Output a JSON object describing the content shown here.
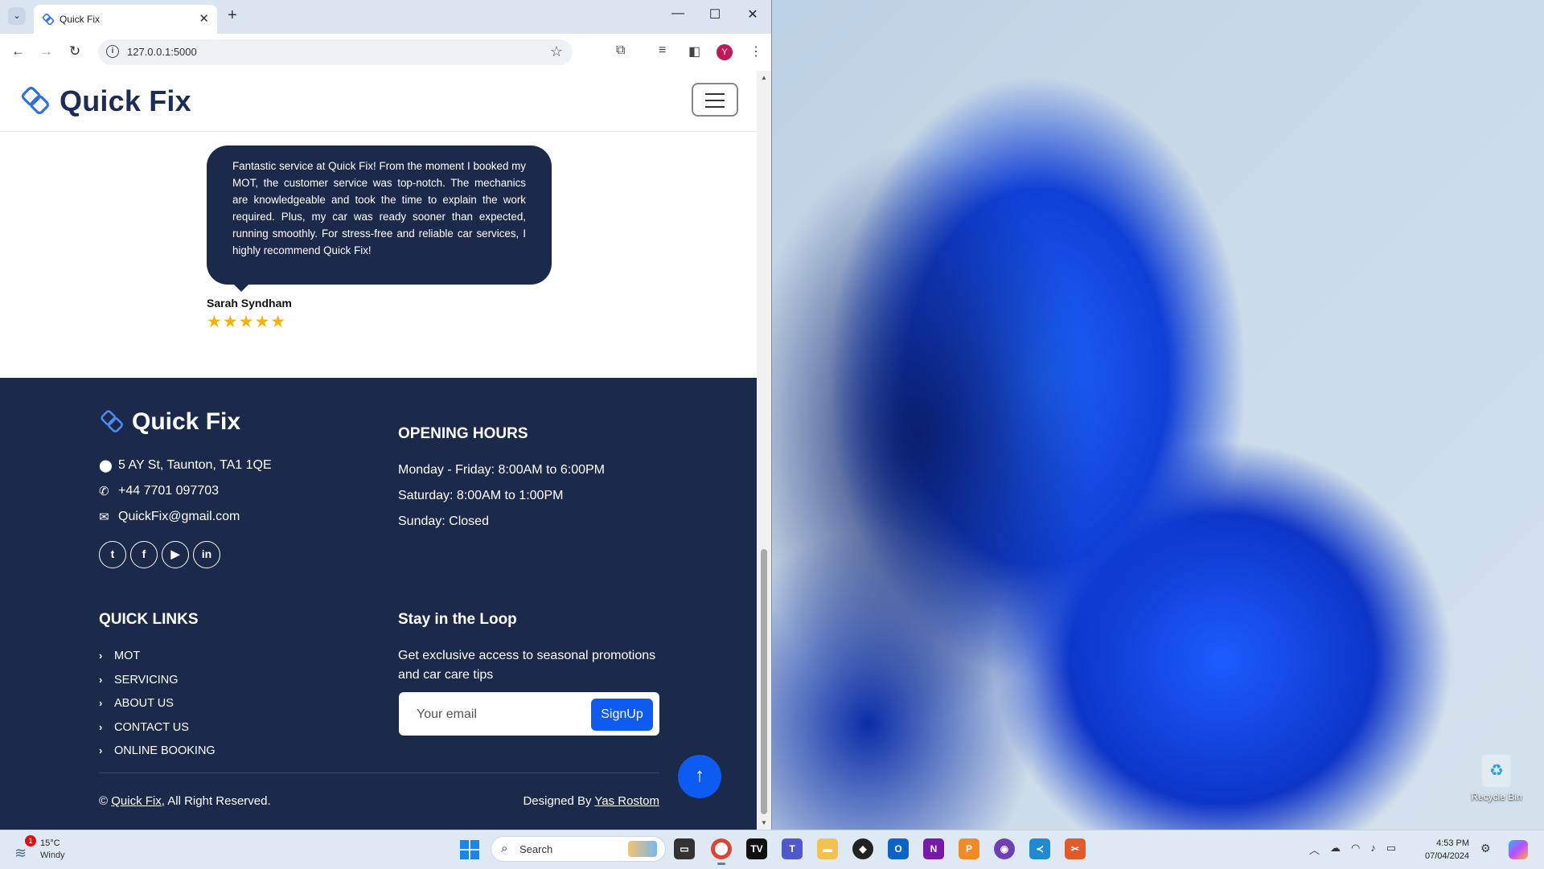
{
  "browser": {
    "tab_title": "Quick Fix",
    "url": "127.0.0.1:5000",
    "profile_initial": "Y"
  },
  "site": {
    "brand": "Quick Fix",
    "testimonial": {
      "text": "Fantastic service at Quick Fix! From the moment I booked my MOT, the customer service was top-notch. The mechanics are knowledgeable and took the time to explain the work required. Plus, my car was ready sooner than expected, running smoothly. For stress-free and reliable car services, I highly recommend Quick Fix!",
      "author": "Sarah Syndham",
      "rating": 5,
      "stars_text": "★★★★★"
    },
    "footer": {
      "brand": "Quick Fix",
      "address": "5 AY St, Taunton, TA1 1QE",
      "phone": "+44 7701 097703",
      "email": "QuickFix@gmail.com",
      "socials": [
        "twitter",
        "facebook",
        "youtube",
        "linkedin"
      ],
      "opening_hours_heading": "OPENING HOURS",
      "hours": [
        "Monday - Friday: 8:00AM to 6:00PM",
        "Saturday: 8:00AM to 1:00PM",
        "Sunday: Closed"
      ],
      "quick_links_heading": "QUICK LINKS",
      "quick_links": [
        "MOT",
        "SERVICING",
        "ABOUT US",
        "CONTACT US",
        "ONLINE BOOKING"
      ],
      "newsletter_heading": "Stay in the Loop",
      "newsletter_text": "Get exclusive access to seasonal promotions and car care tips",
      "email_placeholder": "Your email",
      "signup_label": "SignUp",
      "copyright_symbol": "©",
      "copyright_link": "Quick Fix",
      "copyright_suffix": ", All Right Reserved.",
      "designed_by_prefix": "Designed By ",
      "designer": "Yas Rostom"
    }
  },
  "desktop": {
    "recycle_bin_label": "Recycle Bin"
  },
  "taskbar": {
    "weather_temp": "15°C",
    "weather_condition": "Windy",
    "weather_badge": "1",
    "search_placeholder": "Search",
    "time": "4:53 PM",
    "date": "07/04/2024"
  },
  "colors": {
    "footer_bg": "#1b2a4a",
    "accent_blue": "#0d5bf0",
    "star_gold": "#f5b301"
  }
}
